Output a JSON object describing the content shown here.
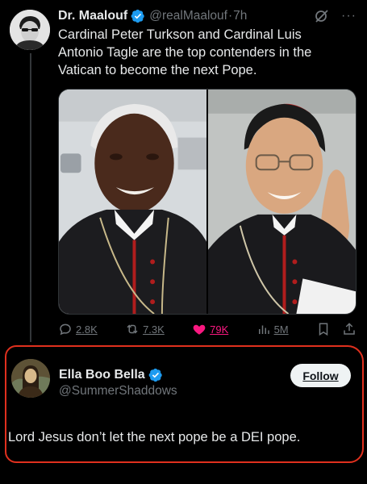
{
  "tweet": {
    "author_name": "Dr. Maalouf",
    "handle": "@realMaalouf",
    "separator": "·",
    "time": "7h",
    "text": "Cardinal Peter Turkson and Cardinal Luis Antonio Tagle are the top contenders in the Vatican to become the next Pope.",
    "icons": {
      "verified": "verified-badge-icon",
      "grok": "grok-icon",
      "more": "more-icon"
    },
    "more_glyph": "···",
    "stats": {
      "replies": "2.8K",
      "reposts": "7.3K",
      "likes": "79K",
      "views": "5M"
    }
  },
  "reply": {
    "author_name": "Ella Boo Bella",
    "handle": "@SummerShaddows",
    "follow_label": "Follow",
    "text": "Lord Jesus don’t let the next pope be a DEI pope."
  },
  "colors": {
    "background": "#000000",
    "text_primary": "#e7e9ea",
    "text_secondary": "#71767b",
    "verified_blue": "#1d9bf0",
    "like_pink": "#f91880",
    "highlight_red": "#e0301e",
    "follow_button_bg": "#eff3f4"
  }
}
